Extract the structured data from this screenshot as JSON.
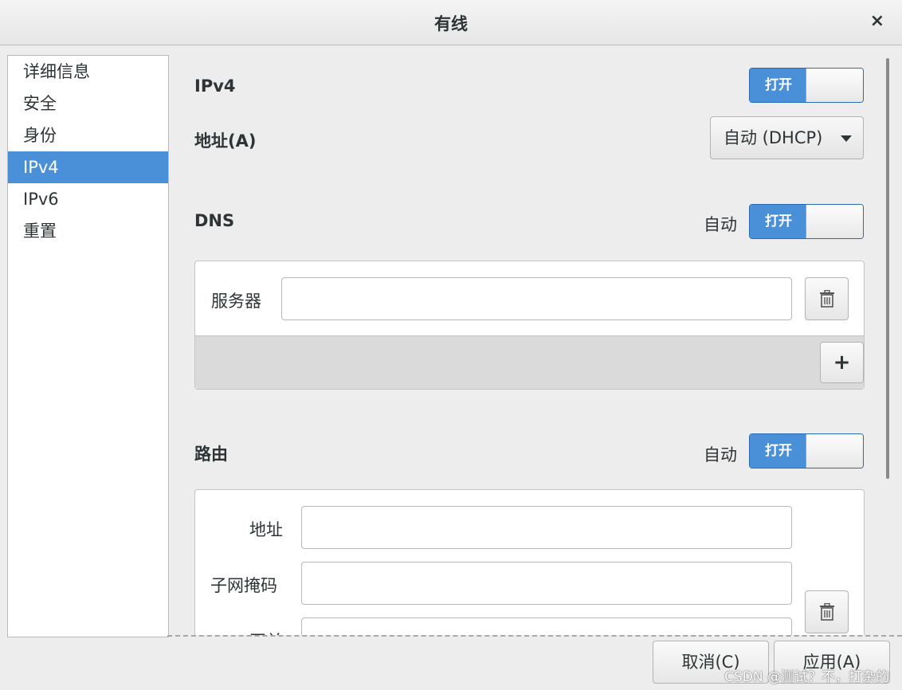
{
  "window": {
    "title": "有线",
    "close_glyph": "×"
  },
  "sidebar": {
    "items": [
      {
        "label": "详细信息"
      },
      {
        "label": "安全"
      },
      {
        "label": "身份"
      },
      {
        "label": "IPv4"
      },
      {
        "label": "IPv6"
      },
      {
        "label": "重置"
      }
    ],
    "selected": "IPv4"
  },
  "ipv4": {
    "heading": "IPv4",
    "switch_label": "打开",
    "address_label": "地址(A)",
    "address_mode": "自动 (DHCP)"
  },
  "dns": {
    "heading": "DNS",
    "auto_label": "自动",
    "switch_label": "打开",
    "server_label": "服务器",
    "server_value": "",
    "add_glyph": "+"
  },
  "routes": {
    "heading": "路由",
    "auto_label": "自动",
    "switch_label": "打开",
    "address_label": "地址",
    "address_value": "",
    "netmask_label": "子网掩码",
    "netmask_value": "",
    "gateway_label": "网关",
    "gateway_value": ""
  },
  "footer": {
    "cancel_label": "取消(C)",
    "apply_label": "应用(A)"
  },
  "watermark": "CSDN @测试？不，打杂的",
  "colors": {
    "accent": "#4a90d9",
    "background": "#ededed"
  },
  "icons": {
    "trash": "trash-icon",
    "caret": "chevron-down-icon",
    "close": "close-icon"
  }
}
